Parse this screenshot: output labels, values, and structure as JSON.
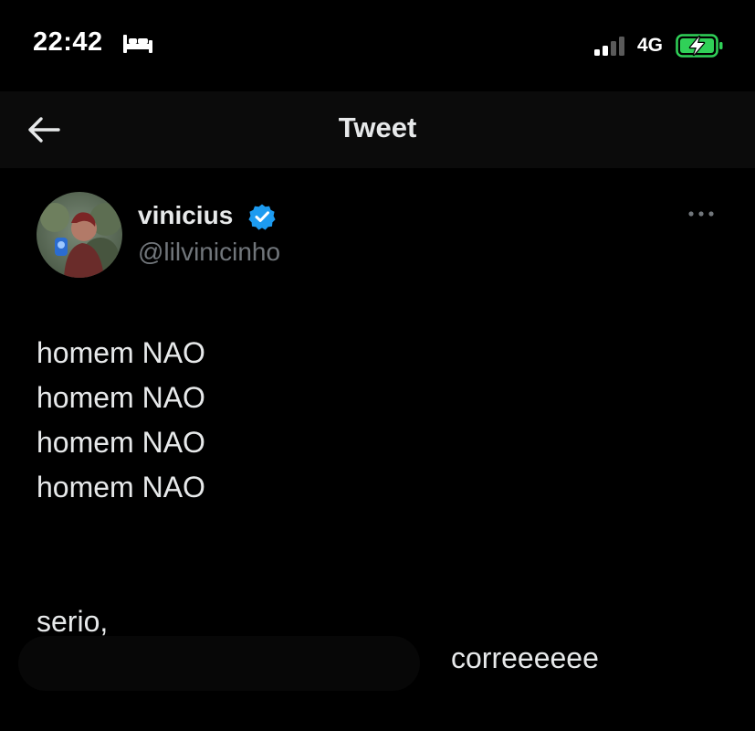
{
  "status_bar": {
    "time": "22:42",
    "network": "4G",
    "icons": [
      "bed-icon",
      "cellular-signal-icon",
      "battery-charging-icon"
    ],
    "battery_color": "#30d158"
  },
  "header": {
    "title": "Tweet",
    "back_icon": "arrow-left-icon"
  },
  "tweet": {
    "author": {
      "display_name": "vinicius",
      "username": "@lilvinicinho",
      "verified": true,
      "verified_color": "#1d9bf0"
    },
    "more_icon": "more-horizontal-icon",
    "lines": [
      "homem NAO",
      "homem NAO",
      "homem NAO",
      "homem NAO"
    ],
    "line_after_gap": "serio,",
    "trailing_text": "correeeeee"
  },
  "colors": {
    "background": "#000000",
    "header_background": "#0b0b0b",
    "text_primary": "#e7e9ea",
    "text_secondary": "#71767b"
  }
}
